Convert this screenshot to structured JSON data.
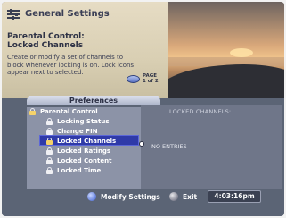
{
  "header": {
    "title": "General Settings",
    "section_title_line1": "Parental Control:",
    "section_title_line2": "Locked Channels",
    "description": "Create or modify a set of channels to block whenever locking is on. Lock icons appear next to selected.",
    "page_label": "PAGE",
    "page_value": "1 of 2"
  },
  "preferences": {
    "heading": "Preferences",
    "parent": "Parental Control",
    "items": [
      {
        "label": "Locking Status"
      },
      {
        "label": "Change PIN"
      },
      {
        "label": "Locked Channels",
        "selected": true
      },
      {
        "label": "Locked Ratings"
      },
      {
        "label": "Locked Content"
      },
      {
        "label": "Locked Time"
      }
    ]
  },
  "content": {
    "label": "LOCKED CHANNELS:",
    "empty_text": "NO ENTRIES"
  },
  "footer": {
    "modify_label": "Modify Settings",
    "exit_label": "Exit",
    "clock": "4:03:16pm"
  },
  "icons": {
    "settings": "settings-icon",
    "lock": "lock-icon",
    "modify": "blue-button-icon",
    "exit": "gray-button-icon"
  },
  "colors": {
    "selection": "#2f3aa8",
    "header_bg": "#d9cfb3",
    "body_bg": "#5b6475"
  }
}
